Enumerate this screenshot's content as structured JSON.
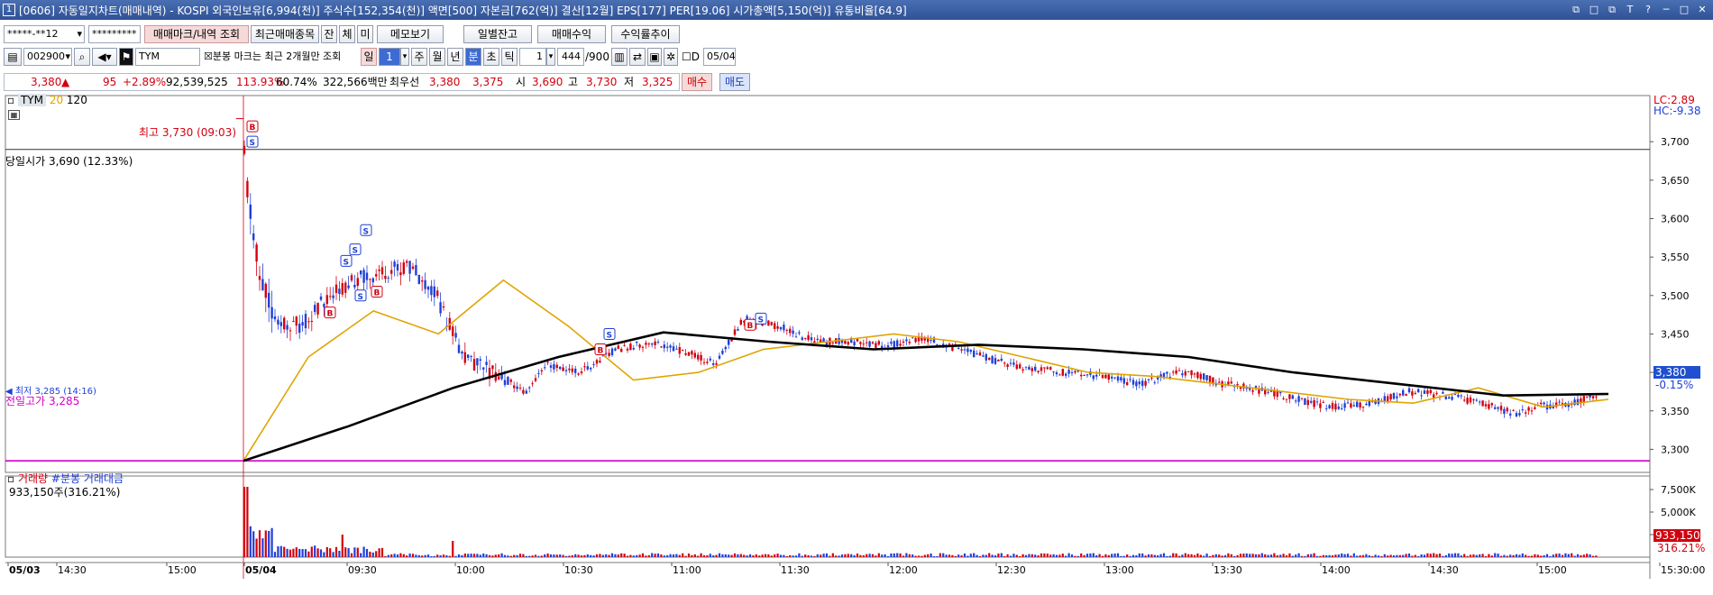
{
  "window": {
    "number": "1",
    "title": "[0606] 자동일지차트(매매내역) - KOSPI 외국인보유[6,994(천)] 주식수[152,354(천)] 액면[500] 자본금[762(억)] 결산[12월] EPS[177] PER[19.06] 시가총액[5,150(억)] 유통비율[64.9]",
    "controls": [
      "⧉",
      "□",
      "⧉",
      "T",
      "?",
      "─",
      "□",
      "✕"
    ]
  },
  "toolbar1": {
    "account": "*****-**12",
    "password": "*********",
    "buttons": [
      "매매마크/내역 조회",
      "최근매매종목",
      "잔",
      "체",
      "미",
      "메모보기",
      "일별잔고",
      "매매수익",
      "수익률추이"
    ]
  },
  "toolbar2": {
    "code": "002900",
    "name": "TYM",
    "note": "분봉 마크는 최근 2개월만 조회",
    "periods": [
      "일",
      "1",
      "주",
      "월",
      "년",
      "분",
      "초",
      "틱"
    ],
    "interval": "1",
    "count": "444",
    "count_max": "/900",
    "date": "05/04",
    "d_label": "D"
  },
  "quote": {
    "price": "3,380",
    "arrow": "▲",
    "change": "95",
    "change_pct": "+2.89%",
    "volume": "92,539,525",
    "vol_ratio": "113.93%",
    "turnover": "60.74%",
    "amount": "322,566백만",
    "bid_label": "최우선",
    "bid1": "3,380",
    "bid2": "3,375",
    "open_label": "시",
    "open": "3,690",
    "high_label": "고",
    "high": "3,730",
    "low_label": "저",
    "low": "3,325",
    "buy": "매수",
    "sell": "매도"
  },
  "price_panel": {
    "legend": {
      "symbol": "TYM",
      "ma1": "20",
      "ma2": "120"
    },
    "high_note": "최고 3,730 (09:03)",
    "open_note": "당일시가 3,690 (12.33%)",
    "low_note": "최저 3,285 (14:16)",
    "prev_close_note": "전일고가 3,285",
    "lc": "LC:2.89",
    "hc": "HC:-9.38",
    "current_label": "3,380",
    "current_pct": "-0.15%"
  },
  "volume_panel": {
    "legend_a": "거래량",
    "legend_b": "#분봉 거래대금",
    "value": "933,150주(316.21%)",
    "current_label": "933,150",
    "current_pct": "316.21%",
    "yticks": [
      "7,500K",
      "5,000K",
      "2,500K"
    ]
  },
  "colors": {
    "up": "#d2000f",
    "down": "#1f3fd8",
    "ma20": "#e0a400",
    "ma120": "#000000",
    "prev_close": "#d400c8",
    "title": "#2f5296"
  },
  "chart_data": {
    "type": "candlestick",
    "x_ticks": [
      "05/03",
      "14:30",
      "15:00",
      "05/04",
      "09:30",
      "10:00",
      "10:30",
      "11:00",
      "11:30",
      "12:00",
      "12:30",
      "13:00",
      "13:30",
      "14:00",
      "14:30",
      "15:00",
      "15:30:00"
    ],
    "y_ticks": [
      "3,700",
      "3,650",
      "3,600",
      "3,550",
      "3,500",
      "3,450",
      "3,400",
      "3,350",
      "3,300"
    ],
    "ylim": [
      3270,
      3760
    ],
    "ma20_values": [
      3285,
      3420,
      3480,
      3450,
      3520,
      3460,
      3390,
      3400,
      3430,
      3440,
      3450,
      3440,
      3420,
      3400,
      3395,
      3385,
      3375,
      3365,
      3360,
      3380,
      3355,
      3365
    ],
    "ma120_values": [
      3285,
      3330,
      3380,
      3420,
      3452,
      3440,
      3430,
      3436,
      3430,
      3420,
      3400,
      3385,
      3370,
      3372
    ],
    "trade_marks": [
      "B",
      "S",
      "S",
      "S",
      "S",
      "B",
      "B",
      "S",
      "B",
      "S",
      "B",
      "S"
    ]
  }
}
